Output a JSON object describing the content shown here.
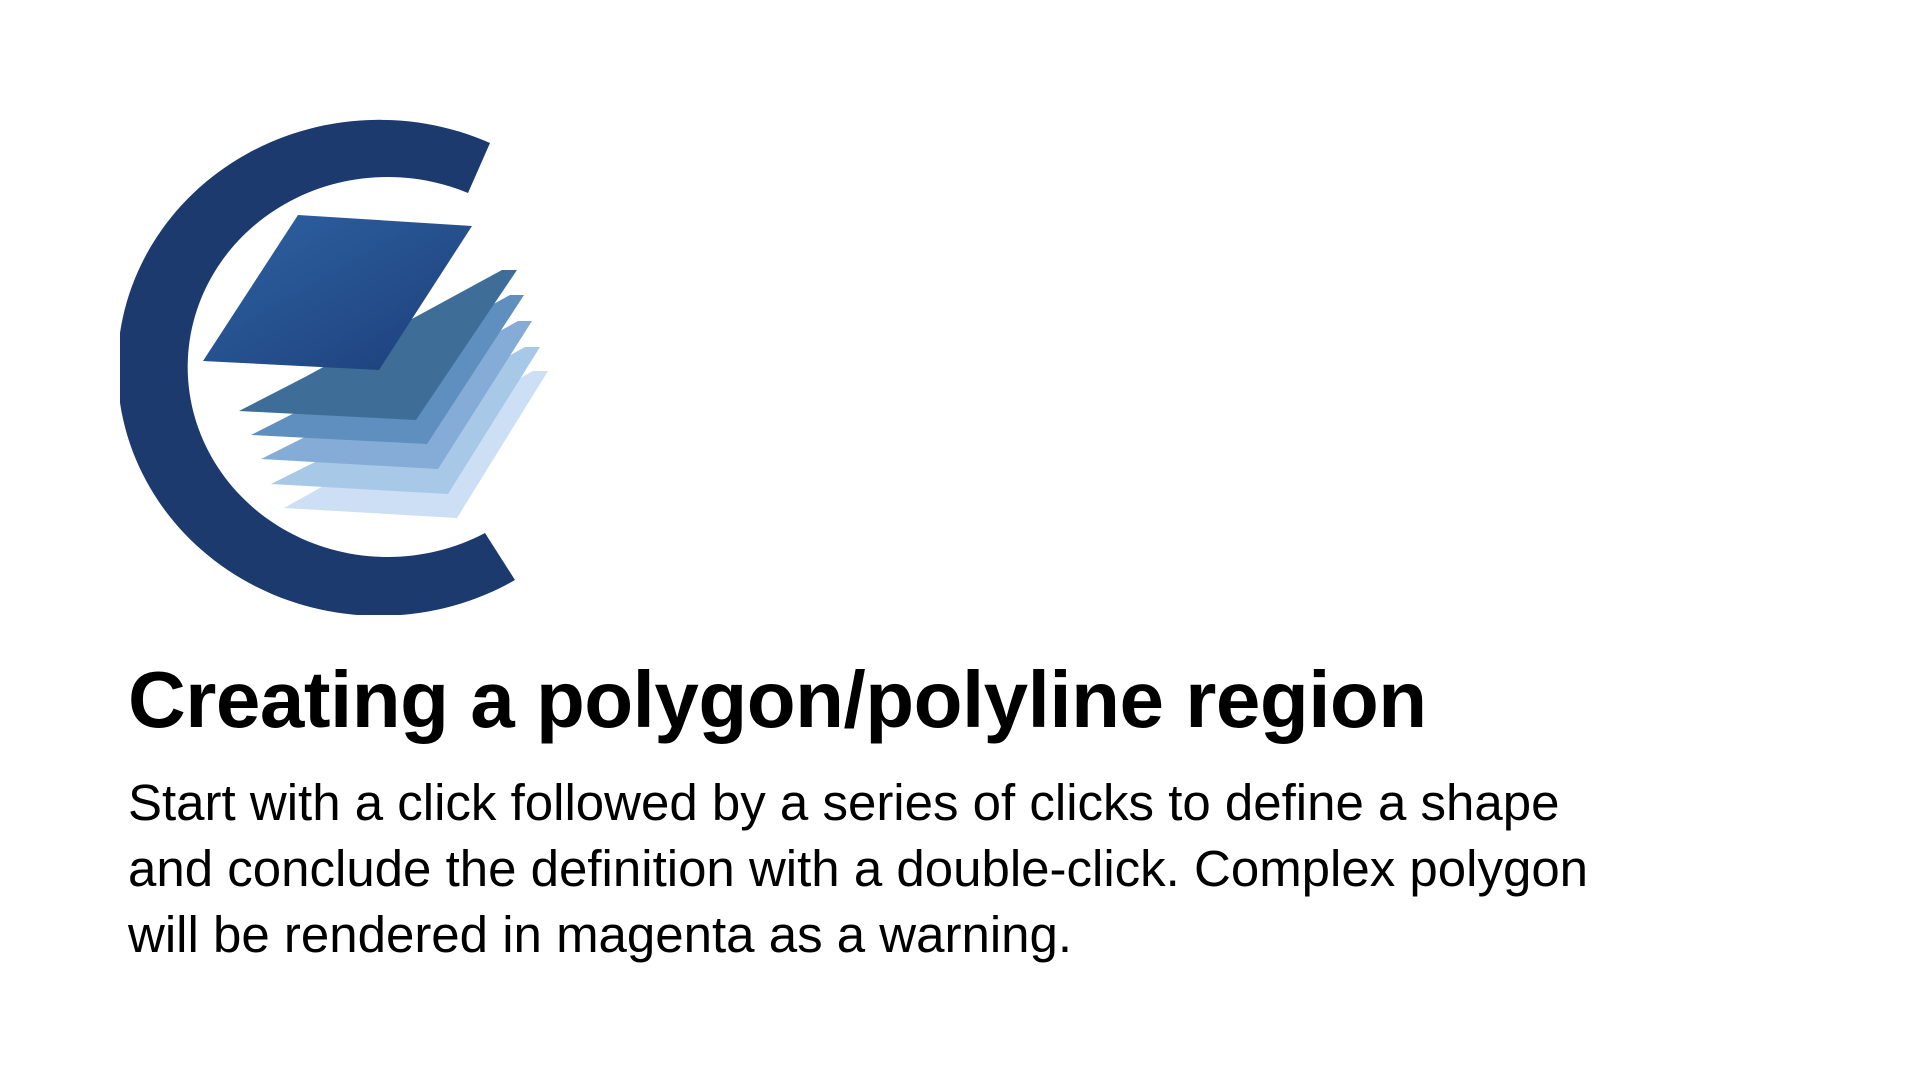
{
  "logo": {
    "name": "layered-polygon-c-logo",
    "colors": {
      "ring": "#1c3a6e",
      "layers": [
        "#ccdff5",
        "#a8c8e8",
        "#84acd6",
        "#5f8fbf",
        "#3e6e98",
        "#2a5b94"
      ]
    }
  },
  "slide": {
    "title": "Creating a polygon/polyline region",
    "description": "Start with a click followed by a series of clicks to define a shape\nand conclude the definition with a double-click. Complex polygon\nwill be rendered in magenta as a warning."
  }
}
